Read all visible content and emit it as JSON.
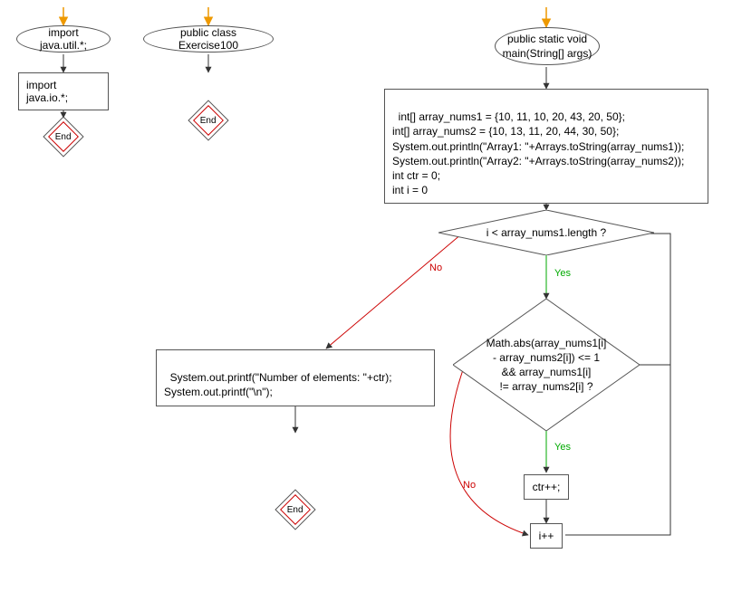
{
  "blocks": {
    "import1": "import java.util.*;",
    "import2": "import java.io.*;",
    "end1": "End",
    "classDecl": "public class Exercise100",
    "end2": "End",
    "mainDecl": "public static void\nmain(String[] args)",
    "initBlock": "int[] array_nums1 = {10, 11, 10, 20, 43, 20, 50};\nint[] array_nums2 = {10, 13, 11, 20, 44, 30, 50};\nSystem.out.println(\"Array1: \"+Arrays.toString(array_nums1));\nSystem.out.println(\"Array2: \"+Arrays.toString(array_nums2));\nint ctr = 0;\nint i = 0",
    "loopCond": "i < array_nums1.length ?",
    "ifCond": "Math.abs(array_nums1[i]\n- array_nums2[i]) <= 1\n&& array_nums1[i]\n!= array_nums2[i] ?",
    "ctrInc": "ctr++;",
    "iInc": "i++",
    "printBlock": "System.out.printf(\"Number of elements: \"+ctr);\nSystem.out.printf(\"\\n\");",
    "end3": "End"
  },
  "labels": {
    "yes": "Yes",
    "no": "No"
  }
}
